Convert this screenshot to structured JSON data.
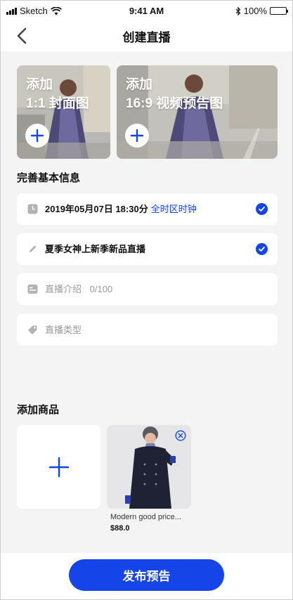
{
  "status_bar": {
    "carrier": "Sketch",
    "time": "9:41 AM",
    "battery": "100%",
    "battery_level": 1.0
  },
  "navbar": {
    "title": "创建直播"
  },
  "covers": [
    {
      "line1": "添加",
      "line2": "1:1 封面图"
    },
    {
      "line1": "添加",
      "line2": "16:9 视频预告图"
    }
  ],
  "basic_info": {
    "title": "完善基本信息",
    "datetime": "2019年05月07日 18:30分",
    "timezone": "全时区时钟",
    "live_title": "夏季女神上新季新品直播",
    "intro_placeholder": "直播介绍",
    "intro_count": "0/100",
    "type_placeholder": "直播类型"
  },
  "products": {
    "title": "添加商品",
    "items": [
      {
        "name": "Modern good price...",
        "price": "$88.0"
      }
    ]
  },
  "bottom": {
    "publish_label": "发布预告"
  },
  "colors": {
    "accent": "#1544e8",
    "background": "#f4f4f5"
  }
}
